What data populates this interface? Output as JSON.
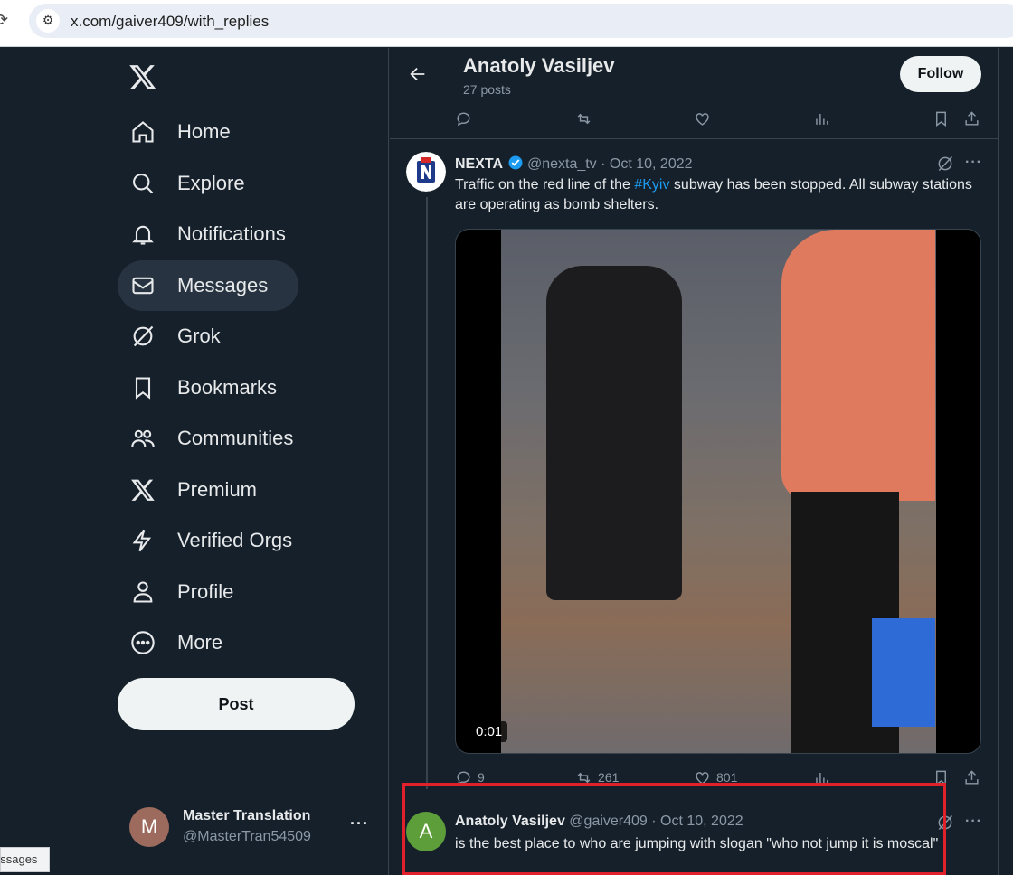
{
  "browser": {
    "url": "x.com/gaiver409/with_replies"
  },
  "sidebar": {
    "logo": "x-logo-icon",
    "items": [
      {
        "label": "Home",
        "icon": "home-icon"
      },
      {
        "label": "Explore",
        "icon": "search-icon"
      },
      {
        "label": "Notifications",
        "icon": "bell-icon"
      },
      {
        "label": "Messages",
        "icon": "envelope-icon"
      },
      {
        "label": "Grok",
        "icon": "grok-icon"
      },
      {
        "label": "Bookmarks",
        "icon": "bookmark-icon"
      },
      {
        "label": "Communities",
        "icon": "people-icon"
      },
      {
        "label": "Premium",
        "icon": "x-logo-icon"
      },
      {
        "label": "Verified Orgs",
        "icon": "lightning-icon"
      },
      {
        "label": "Profile",
        "icon": "person-icon"
      },
      {
        "label": "More",
        "icon": "more-circle-icon"
      }
    ],
    "post_label": "Post",
    "account": {
      "avatar_letter": "M",
      "name": "Master Translation",
      "handle": "@MasterTran54509",
      "more": "···"
    },
    "tooltip": "essages"
  },
  "header": {
    "name": "Anatoly Vasiljev",
    "posts": "27 posts",
    "follow_label": "Follow"
  },
  "tweet": {
    "name": "NEXTA",
    "handle": "@nexta_tv",
    "date": "Oct 10, 2022",
    "text_before": "Traffic on the red line of the ",
    "hashtag": "#Kyiv",
    "text_after": " subway has been stopped. All subway stations are operating as bomb shelters.",
    "duration": "0:01",
    "replies": "9",
    "reposts": "261",
    "likes": "801"
  },
  "reply": {
    "avatar_letter": "A",
    "name": "Anatoly Vasiljev",
    "handle": "@gaiver409",
    "date": "Oct 10, 2022",
    "text": "is the best place to who are jumping with slogan \"who not jump it is moscal\""
  },
  "more_dots": "···",
  "separator": " · ",
  "colors": {
    "background": "#15202b",
    "accent": "#1d9bf0",
    "highlight": "#e0202a"
  }
}
